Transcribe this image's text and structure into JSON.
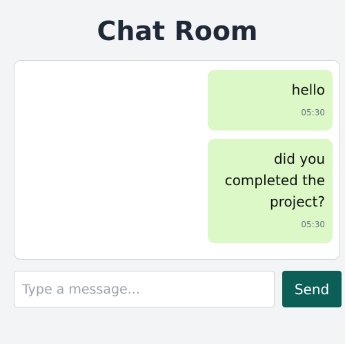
{
  "header": {
    "title": "Chat Room"
  },
  "messages": [
    {
      "lines": [
        "hello"
      ],
      "time": "05:30"
    },
    {
      "lines": [
        "did you",
        "completed the",
        "project?"
      ],
      "time": "05:30"
    }
  ],
  "composer": {
    "value": "",
    "placeholder": "Type a message...",
    "send_label": "Send"
  },
  "colors": {
    "background": "#f3f4f6",
    "bubble": "#dcf8c6",
    "send_button": "#0b5f56",
    "title": "#1f2937"
  }
}
